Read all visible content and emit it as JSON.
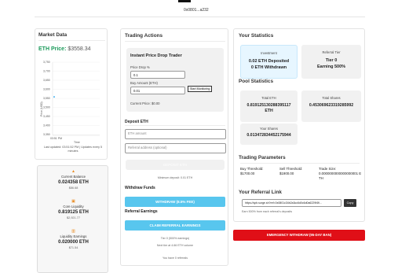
{
  "header": {
    "wallet": "0x0801...a232"
  },
  "market": {
    "title": "Market Data",
    "price_label": "ETH Price:",
    "price_value": "$3558.34",
    "yticks": [
      "3,750",
      "3,700",
      "3,650",
      "3,600",
      "3,550",
      "3,500",
      "3,450",
      "3,400",
      "3,350"
    ],
    "ylabel": "Price (USD)",
    "xlabel": "Time",
    "xtick": "03:51 PM",
    "updated": "Last updated: 03:51:52 PM",
    "updates": "Updates every 5 minutes"
  },
  "chart_data": {
    "type": "line",
    "x": [
      "03:51 PM"
    ],
    "series": [
      {
        "values": [
          3558.34
        ]
      }
    ],
    "ylabel": "Price (USD)",
    "xlabel": "Time",
    "ylim": [
      3350,
      3750
    ]
  },
  "stats_left": [
    {
      "label": "Current Balance",
      "value": "0.024358 ETH",
      "sub": "$86.68"
    },
    {
      "label": "Core Liquidity",
      "value": "0.819125 ETH",
      "sub": "$2,921.77"
    },
    {
      "label": "Liquidity Earnings",
      "value": "0.020000 ETH",
      "sub": "$71.54"
    }
  ],
  "trading": {
    "title": "Trading Actions",
    "trader_title": "Instant Price Drop Trader",
    "price_drop_label": "Price Drop %",
    "price_drop_value": "0.1",
    "buy_label": "Buy Amount (ETH)",
    "buy_value": "0.01",
    "start_btn": "Start Monitoring",
    "current_price": "Current Price: $0.00",
    "deposit_title": "Deposit ETH",
    "eth_placeholder": "ETH amount",
    "ref_placeholder": "Referral address (optional)",
    "deposit_btn": "DEPOSIT ETH",
    "min_deposit": "Minimum deposit: 0.01 ETH",
    "withdraw_title": "Withdraw Funds",
    "withdraw_btn": "WITHDRAW (8.5% FEE)",
    "earnings_title": "Referral Earnings",
    "claim_btn": "CLAIM REFERRAL EARNINGS",
    "tier": "Tier 0 (500% earnings)",
    "next_tier": "Next tier at 4.66 ETH volume",
    "referrals": "You have 0 referrals"
  },
  "your_stats": {
    "title": "Your Statistics",
    "investment_label": "Investment",
    "deposited": "0.02 ETH Deposited",
    "withdrawn": "0 ETH Withdrawn",
    "tier_label": "Referral Tier",
    "tier_value": "Tier 0",
    "earning": "Earning 500%"
  },
  "pool": {
    "title": "Pool Statistics",
    "total_eth_label": "Total ETH",
    "total_eth_value": "0.819125130288395117 ETH",
    "total_shares_label": "Total Shares",
    "total_shares_value": "0.453069623319285992",
    "your_shares_label": "Your Shares",
    "your_shares_value": "0.013472834452175944"
  },
  "params": {
    "title": "Trading Parameters",
    "buy_label": "Buy Threshold:",
    "buy_value": "$1700.00",
    "sell_label": "Sell Threshold:",
    "sell_value": "$1900.00",
    "trade_label": "Trade Size:",
    "trade_value": "0.0000000000000000001 ETH"
  },
  "referral": {
    "title": "Your Referral Link",
    "link": "https://spb.surge.sh?ref=0x0801c34b2a3cc6d0c6d0a6229f4fi...",
    "copy": "Copy",
    "note": "Earn 500% from each referral's deposits"
  },
  "emergency": {
    "label": "EMERGENCY WITHDRAW (95-DAY BAN)"
  },
  "colors": {
    "accent": "#58c6ee",
    "danger": "#e00f17",
    "green": "#1b9a5a"
  }
}
